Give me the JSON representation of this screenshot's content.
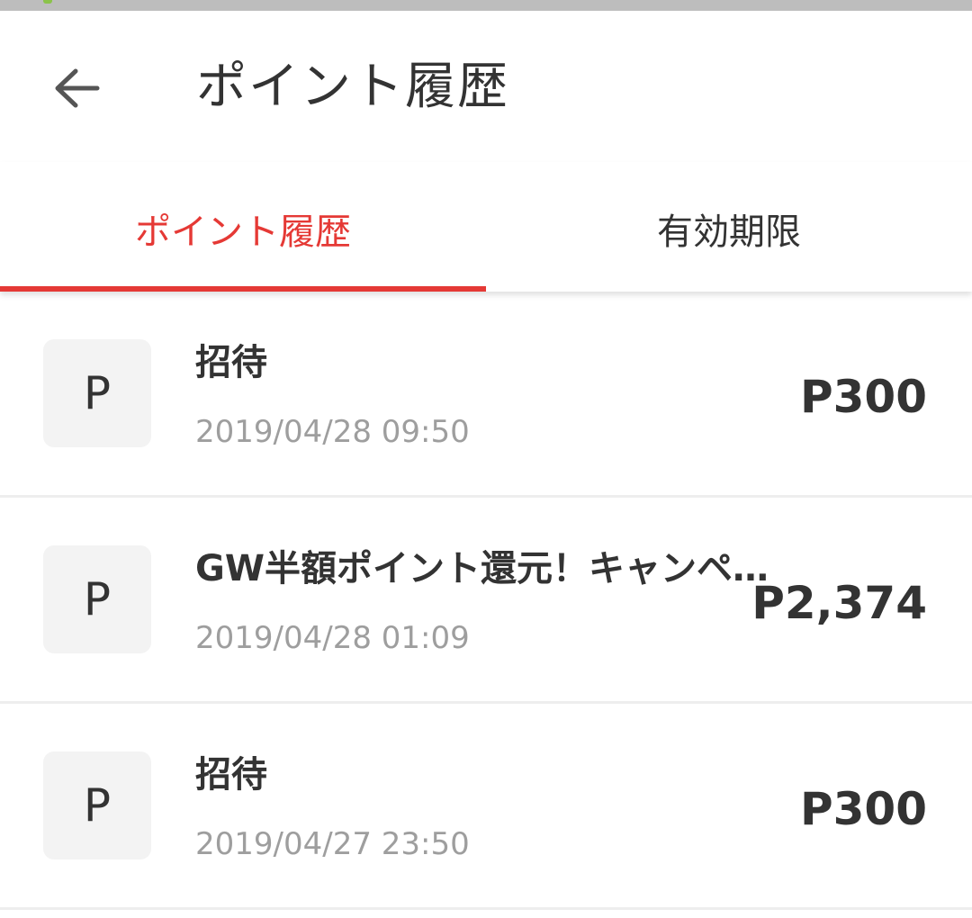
{
  "header": {
    "title": "ポイント履歴",
    "back_icon": "arrow-left-icon"
  },
  "tabs": [
    {
      "label": "ポイント履歴",
      "selected": true
    },
    {
      "label": "有効期限",
      "selected": false
    }
  ],
  "colors": {
    "accent": "#e53935",
    "text": "#333333",
    "subtext": "#9e9e9e",
    "badge_bg": "#f3f3f3"
  },
  "history": [
    {
      "badge": "P",
      "title": "招待",
      "date": "2019/04/28 09:50",
      "amount": "P300"
    },
    {
      "badge": "P",
      "title": "GW半額ポイント還元！キャンペーン",
      "date": "2019/04/28 01:09",
      "amount": "P2,374"
    },
    {
      "badge": "P",
      "title": "招待",
      "date": "2019/04/27 23:50",
      "amount": "P300"
    }
  ]
}
